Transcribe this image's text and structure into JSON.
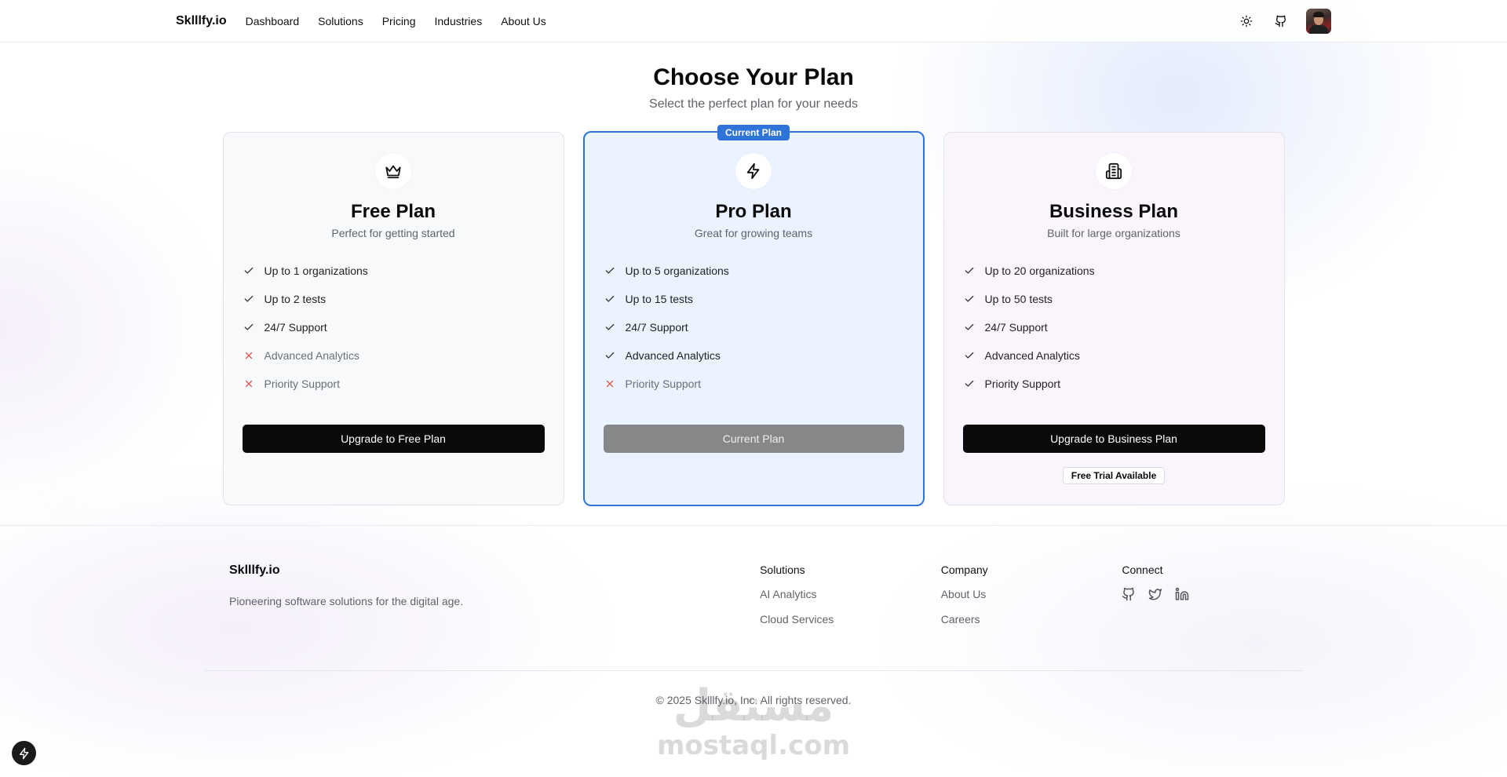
{
  "header": {
    "brand": "Sklllfy.io",
    "nav": [
      "Dashboard",
      "Solutions",
      "Pricing",
      "Industries",
      "About Us"
    ],
    "icons": [
      "sun-icon",
      "github-icon"
    ]
  },
  "hero": {
    "title": "Choose Your Plan",
    "subtitle": "Select the perfect plan for your needs"
  },
  "plans": [
    {
      "icon": "crown-icon",
      "name": "Free Plan",
      "description": "Perfect for getting started",
      "features": [
        {
          "label": "Up to 1 organizations",
          "included": true
        },
        {
          "label": "Up to 2 tests",
          "included": true
        },
        {
          "label": "24/7 Support",
          "included": true
        },
        {
          "label": "Advanced Analytics",
          "included": false
        },
        {
          "label": "Priority Support",
          "included": false
        }
      ],
      "cta": "Upgrade to Free Plan"
    },
    {
      "icon": "lightning-icon",
      "badge": "Current Plan",
      "name": "Pro Plan",
      "description": "Great for growing teams",
      "features": [
        {
          "label": "Up to 5 organizations",
          "included": true
        },
        {
          "label": "Up to 15 tests",
          "included": true
        },
        {
          "label": "24/7 Support",
          "included": true
        },
        {
          "label": "Advanced Analytics",
          "included": true
        },
        {
          "label": "Priority Support",
          "included": false
        }
      ],
      "cta": "Current Plan"
    },
    {
      "icon": "building-icon",
      "name": "Business Plan",
      "description": "Built for large organizations",
      "features": [
        {
          "label": "Up to 20 organizations",
          "included": true
        },
        {
          "label": "Up to 50 tests",
          "included": true
        },
        {
          "label": "24/7 Support",
          "included": true
        },
        {
          "label": "Advanced Analytics",
          "included": true
        },
        {
          "label": "Priority Support",
          "included": true
        }
      ],
      "cta": "Upgrade to Business Plan",
      "note": "Free Trial Available"
    }
  ],
  "footer": {
    "brand": "Sklllfy.io",
    "tagline": "Pioneering software solutions for the digital age.",
    "solutions": {
      "title": "Solutions",
      "links": [
        "AI Analytics",
        "Cloud Services"
      ]
    },
    "company": {
      "title": "Company",
      "links": [
        "About Us",
        "Careers"
      ]
    },
    "connect": {
      "title": "Connect",
      "icons": [
        "github-icon",
        "twitter-icon",
        "linkedin-icon"
      ]
    },
    "copyright": "© 2025 Sklllfy.io, Inc. All rights reserved."
  },
  "watermark": {
    "arabic": "مستقل",
    "latin": "mostaql.com"
  },
  "colors": {
    "accent": "#2f74d8",
    "primary_button": "#0a0a0a",
    "disabled_button": "#868789",
    "excluded_mark": "#d9534f"
  }
}
